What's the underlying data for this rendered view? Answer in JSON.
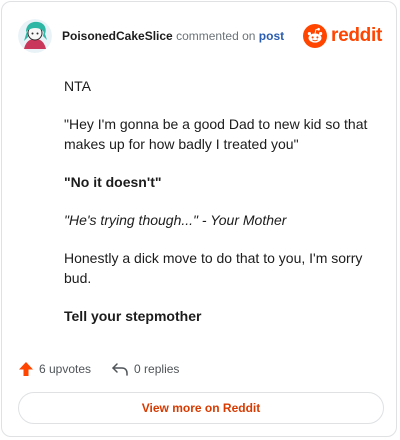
{
  "header": {
    "username": "PoisonedCakeSlice",
    "action_text": "commented on",
    "post_link": "post",
    "brand": "reddit"
  },
  "comment": {
    "paragraphs": [
      "NTA",
      "\"Hey I'm gonna be a good Dad to new kid so that makes up for how badly I treated you\"",
      "\"No it doesn't\"",
      "\"He's trying though...\" - Your Mother",
      "Honestly a dick move to do that to you, I'm sorry bud.",
      "Tell your stepmother"
    ]
  },
  "actions": {
    "upvotes": "6 upvotes",
    "replies": "0 replies"
  },
  "view_more": {
    "label": "View more on Reddit"
  },
  "colors": {
    "accent": "#ff4500",
    "link": "#2a5db0",
    "button_text": "#d93a00"
  },
  "icons": {
    "upvote": "upvote-arrow-icon",
    "reply": "reply-arrow-icon",
    "brand": "reddit-snoo-icon",
    "avatar": "user-avatar"
  }
}
